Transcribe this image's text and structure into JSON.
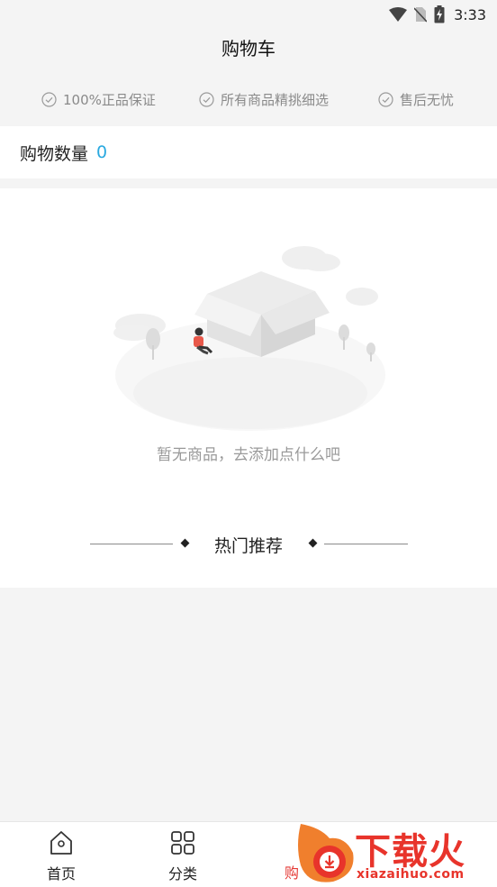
{
  "status_bar": {
    "time": "3:33",
    "icons": [
      "wifi-icon",
      "no-sim-icon",
      "battery-charging-icon"
    ]
  },
  "header": {
    "title": "购物车"
  },
  "guarantees": [
    {
      "icon": "check-circle-icon",
      "label": "100%正品保证"
    },
    {
      "icon": "check-circle-icon",
      "label": "所有商品精挑细选"
    },
    {
      "icon": "check-circle-icon",
      "label": "售后无忧"
    }
  ],
  "cart": {
    "count_label": "购物数量",
    "count_value": "0"
  },
  "empty_state": {
    "message": "暂无商品，去添加点什么吧"
  },
  "recommend": {
    "title": "热门推荐"
  },
  "tab_bar": {
    "items": [
      {
        "icon": "home-icon",
        "label": "首页"
      },
      {
        "icon": "grid-icon",
        "label": "分类"
      },
      {
        "icon": "cart-icon",
        "label": "购"
      }
    ],
    "active_color": "#e53935"
  },
  "watermark": {
    "brand": "下载火",
    "url": "xiazaihuo.com"
  },
  "colors": {
    "accent": "#2aa9e0",
    "background": "#f4f4f4",
    "muted_text": "#9a9a9a"
  }
}
